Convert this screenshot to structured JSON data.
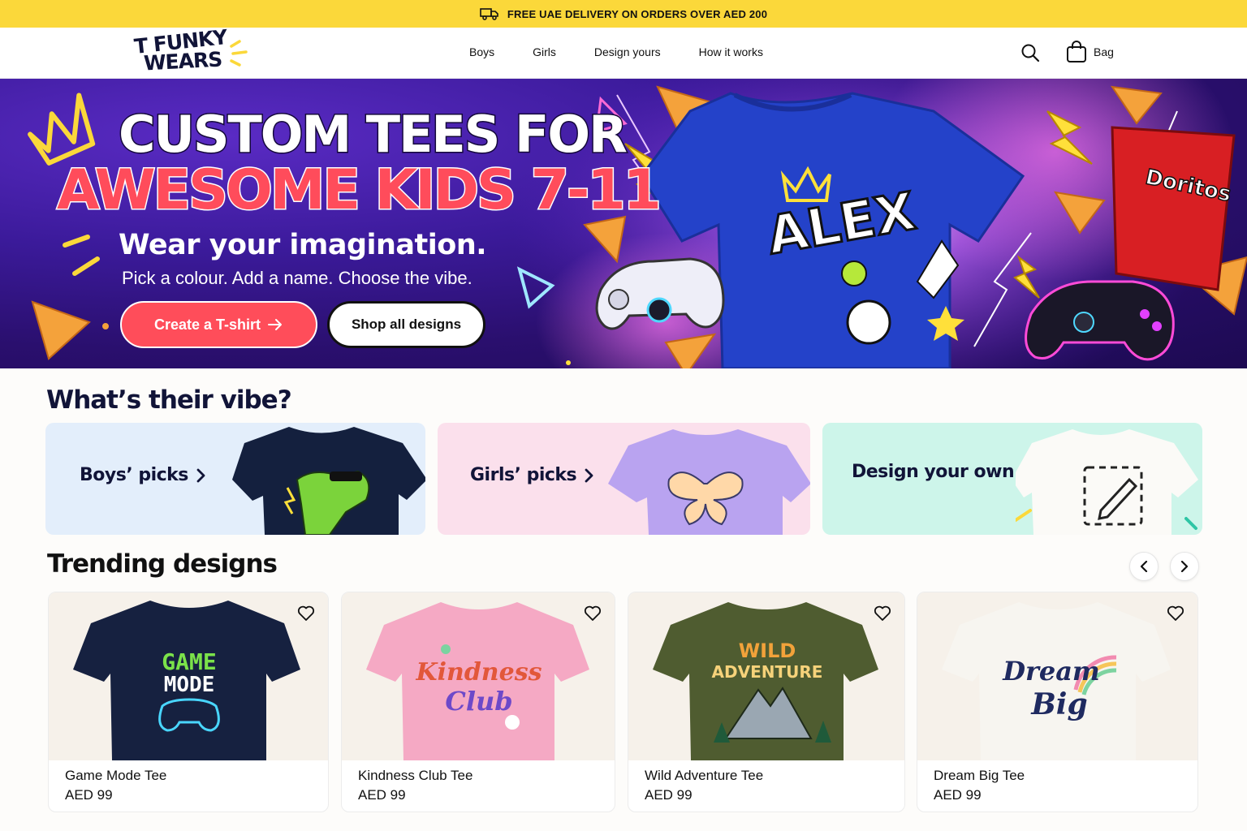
{
  "promo": {
    "text": "FREE UAE DELIVERY ON ORDERS OVER AED 200",
    "icon": "truck-icon"
  },
  "header": {
    "logo_line1": "T FUNKY",
    "logo_line2": "WEARS",
    "nav": [
      "Boys",
      "Girls",
      "Design yours",
      "How it works"
    ],
    "bag_label": "Bag"
  },
  "hero": {
    "headline1": "CUSTOM TEES FOR",
    "headline2": "AWESOME KIDS 7-11",
    "subhead": "Wear your imagination.",
    "tagline": "Pick a colour. Add a name. Choose the vibe.",
    "cta_primary": "Create a T-shirt",
    "cta_secondary": "Shop all designs",
    "shirt_name": "ALEX",
    "snack_brand": "Doritos"
  },
  "vibe": {
    "title": "What’s their vibe?",
    "cards": [
      {
        "label": "Boys’ picks"
      },
      {
        "label": "Girls’ picks"
      },
      {
        "label": "Design your own"
      }
    ]
  },
  "trending": {
    "title": "Trending designs",
    "products": [
      {
        "name": "Game Mode Tee",
        "price": "AED 99",
        "art_line1": "GAME",
        "art_line2": "MODE"
      },
      {
        "name": "Kindness Club Tee",
        "price": "AED 99",
        "art_line1": "Kindness",
        "art_line2": "Club"
      },
      {
        "name": "Wild Adventure Tee",
        "price": "AED 99",
        "art_line1": "WILD",
        "art_line2": "ADVENTURE"
      },
      {
        "name": "Dream Big Tee",
        "price": "AED 99",
        "art_line1": "Dream",
        "art_line2": "Big"
      }
    ]
  },
  "colors": {
    "promo_bar": "#fbd83a",
    "accent_red": "#ff4d5a",
    "navy": "#111438"
  }
}
